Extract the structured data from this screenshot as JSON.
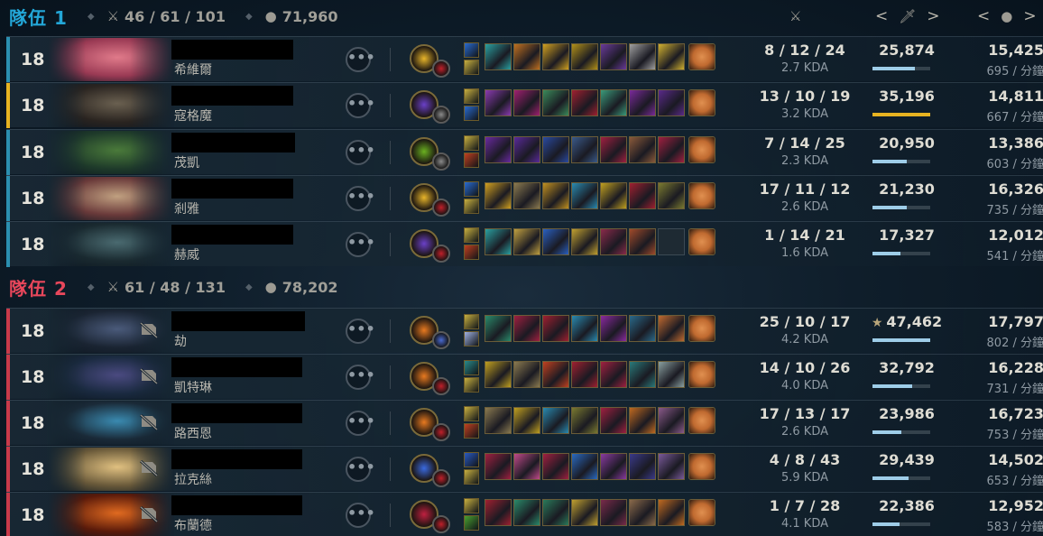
{
  "header_columns": {
    "kda_icon": "crossed-swords-icon",
    "damage_icon": "sword-icon",
    "gold_icon": "coins-icon",
    "prev": "<",
    "next": ">"
  },
  "teams": [
    {
      "title": "隊伍 1",
      "color": "#23a7d8",
      "kda": "46 / 61 / 101",
      "gold": "71,960",
      "players": [
        {
          "level": "18",
          "name": "希維爾",
          "kda": "8 / 12 / 24",
          "kda_ratio": "2.7 KDA",
          "damage": "25,874",
          "damage_frac": 0.74,
          "gold": "15,425",
          "gpm": "695 / 分鐘",
          "bar": "#2b8fb0",
          "portrait": [
            "#9a3a54",
            "#e07a8a"
          ],
          "rune": "#e8b52a",
          "sub": "#c0202a",
          "spells": [
            "#2a6bd0",
            "#c8b040"
          ],
          "items": [
            "#2aa0a0",
            "#c07020",
            "#d0a020",
            "#b09018",
            "#6a3a9a",
            "#a0a0a0",
            "#d0b030"
          ],
          "trinket": "#c06a30"
        },
        {
          "level": "18",
          "name": "寇格魔",
          "kda": "13 / 10 / 19",
          "kda_ratio": "3.2 KDA",
          "damage": "35,196",
          "damage_frac": 1.0,
          "top": true,
          "gold": "14,811",
          "gpm": "667 / 分鐘",
          "bar": "#e7b321",
          "portrait": [
            "#2a2420",
            "#6a6050"
          ],
          "rune": "#6a40c8",
          "sub": "#8a8a8a",
          "spells": [
            "#c8b040",
            "#2a6bd0"
          ],
          "items": [
            "#8a3ab0",
            "#a02070",
            "#3a8a5a",
            "#a02030",
            "#3a9a7a",
            "#7a2a9a",
            "#5a2a8a"
          ],
          "trinket": "#c06a30"
        },
        {
          "level": "18",
          "name": "茂凱",
          "kda": "7 / 14 / 25",
          "kda_ratio": "2.3 KDA",
          "damage": "20,950",
          "damage_frac": 0.6,
          "gold": "13,386",
          "gpm": "603 / 分鐘",
          "bar": "#2b8fb0",
          "portrait": [
            "#1e3a2a",
            "#4a7a3a"
          ],
          "rune": "#6ab020",
          "sub": "#8a8a8a",
          "spells": [
            "#c8b040",
            "#c04020"
          ],
          "items": [
            "#6a2aa0",
            "#5a2a9a",
            "#2a4aa0",
            "#3a5a8a",
            "#a02040",
            "#8a5a3a",
            "#a02040"
          ],
          "trinket": "#c06a30"
        },
        {
          "level": "18",
          "name": "剎雅",
          "kda": "17 / 11 / 12",
          "kda_ratio": "2.6 KDA",
          "damage": "21,230",
          "damage_frac": 0.6,
          "gold": "16,326",
          "gpm": "735 / 分鐘",
          "bar": "#2b8fb0",
          "portrait": [
            "#6a3a3a",
            "#c0a080"
          ],
          "rune": "#e8b52a",
          "sub": "#c0202a",
          "spells": [
            "#2a6bd0",
            "#c8b040"
          ],
          "items": [
            "#d0a020",
            "#8a7a50",
            "#c09020",
            "#2a8ab0",
            "#c0a020",
            "#a02030",
            "#7a7a30"
          ],
          "trinket": "#c06a30"
        },
        {
          "level": "18",
          "name": "赫威",
          "kda": "1 / 14 / 21",
          "kda_ratio": "1.6 KDA",
          "damage": "17,327",
          "damage_frac": 0.49,
          "gold": "12,012",
          "gpm": "541 / 分鐘",
          "bar": "#2b8fb0",
          "portrait": [
            "#1a2a30",
            "#4a6a70"
          ],
          "rune": "#6a40c8",
          "sub": "#c0202a",
          "spells": [
            "#c8b040",
            "#c04020"
          ],
          "items": [
            "#2aa0a0",
            "#c0a040",
            "#2a60c0",
            "#c0a030",
            "#8a2a4a",
            "#a04a2a"
          ],
          "empty_items": 1,
          "trinket": "#c06a30"
        }
      ]
    },
    {
      "title": "隊伍 2",
      "color": "#e8475b",
      "kda": "61 / 48 / 131",
      "gold": "78,202",
      "players": [
        {
          "level": "18",
          "name": "劫",
          "kda": "25 / 10 / 17",
          "kda_ratio": "4.2 KDA",
          "damage": "47,462",
          "damage_frac": 1.0,
          "mvp": "★",
          "gold": "17,797",
          "gpm": "802 / 分鐘",
          "bar": "#c83a4a",
          "portrait": [
            "#1a2432",
            "#4a5a7a"
          ],
          "rune": "#e87a20",
          "sub": "#4a6ad0",
          "spells": [
            "#c8b040",
            "#a0b0e0"
          ],
          "items": [
            "#2a8a6a",
            "#a02040",
            "#a02030",
            "#2a8ab0",
            "#8a2aa0",
            "#2a6a8a",
            "#c06a30"
          ],
          "trinket": "#c06a30"
        },
        {
          "level": "18",
          "name": "凱特琳",
          "kda": "14 / 10 / 26",
          "kda_ratio": "4.0 KDA",
          "damage": "32,792",
          "damage_frac": 0.69,
          "gold": "16,228",
          "gpm": "731 / 分鐘",
          "bar": "#c83a4a",
          "portrait": [
            "#1a2a40",
            "#4a4a80"
          ],
          "rune": "#e87a20",
          "sub": "#c0202a",
          "spells": [
            "#2a8a8a",
            "#c8b040"
          ],
          "items": [
            "#c0a020",
            "#8a7a50",
            "#c04020",
            "#a02030",
            "#a02040",
            "#2a7a7a",
            "#8aa0a0"
          ],
          "trinket": "#c06a30"
        },
        {
          "level": "18",
          "name": "路西恩",
          "kda": "17 / 13 / 17",
          "kda_ratio": "2.6 KDA",
          "damage": "23,986",
          "damage_frac": 0.5,
          "gold": "16,723",
          "gpm": "753 / 分鐘",
          "bar": "#c83a4a",
          "portrait": [
            "#1a2a38",
            "#3a8ab0"
          ],
          "rune": "#e87a20",
          "sub": "#c0202a",
          "spells": [
            "#c8b040",
            "#c04020"
          ],
          "items": [
            "#8a7a50",
            "#c0a020",
            "#2a8ab0",
            "#7a7a30",
            "#a02040",
            "#c06a20",
            "#8a5a8a"
          ],
          "trinket": "#c06a30"
        },
        {
          "level": "18",
          "name": "拉克絲",
          "kda": "4 / 8 / 43",
          "kda_ratio": "5.9 KDA",
          "damage": "29,439",
          "damage_frac": 0.62,
          "gold": "14,502",
          "gpm": "653 / 分鐘",
          "bar": "#c83a4a",
          "portrait": [
            "#6a5a3a",
            "#e0c080"
          ],
          "rune": "#3a6ae0",
          "sub": "#c0202a",
          "spells": [
            "#2a5ac0",
            "#c8b040"
          ],
          "items": [
            "#a02040",
            "#c04a8a",
            "#a02040",
            "#2a6ac0",
            "#8a3aa0",
            "#3a3a8a",
            "#7a5a9a"
          ],
          "trinket": "#c06a30"
        },
        {
          "level": "18",
          "name": "布蘭德",
          "kda": "1 / 7 / 28",
          "kda_ratio": "4.1 KDA",
          "damage": "22,386",
          "damage_frac": 0.47,
          "gold": "12,952",
          "gpm": "583 / 分鐘",
          "bar": "#c83a4a",
          "portrait": [
            "#5a1a0a",
            "#e06a20"
          ],
          "rune": "#c02040",
          "sub": "#c0202a",
          "spells": [
            "#c8b040",
            "#4aa030"
          ],
          "items": [
            "#a02030",
            "#2a8a6a",
            "#2a7a5a",
            "#c0a030",
            "#7a2a4a",
            "#8a6a4a",
            "#c06a20"
          ],
          "trinket": "#c06a30"
        }
      ]
    }
  ]
}
